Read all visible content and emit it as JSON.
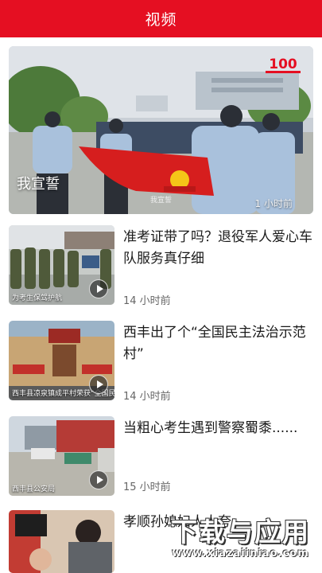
{
  "header": {
    "title": "视频"
  },
  "featured": {
    "title": "我宣誓",
    "time": "1 小时前",
    "logo_text": "100",
    "subtitle": "我宣誓"
  },
  "items": [
    {
      "title": "准考证带了吗？退役军人爱心车队服务真仔细",
      "time": "14 小时前",
      "caption": "为考生保驾护航"
    },
    {
      "title": "西丰出了个“全国民主法治示范村”",
      "time": "14 小时前",
      "caption": "西丰县凉泉镇成平村荣获“全国民主法治示范村”称号"
    },
    {
      "title": "当粗心考生遇到警察蜀黍......",
      "time": "15 小时前",
      "caption": "西丰县公安局"
    },
    {
      "title": "孝顺孙媳妇人人夸",
      "time": "",
      "caption": ""
    }
  ],
  "watermark": {
    "main": "下载与应用",
    "url": "www.xiazaiiniao.com"
  },
  "colors": {
    "brand_red": "#e50f22"
  }
}
